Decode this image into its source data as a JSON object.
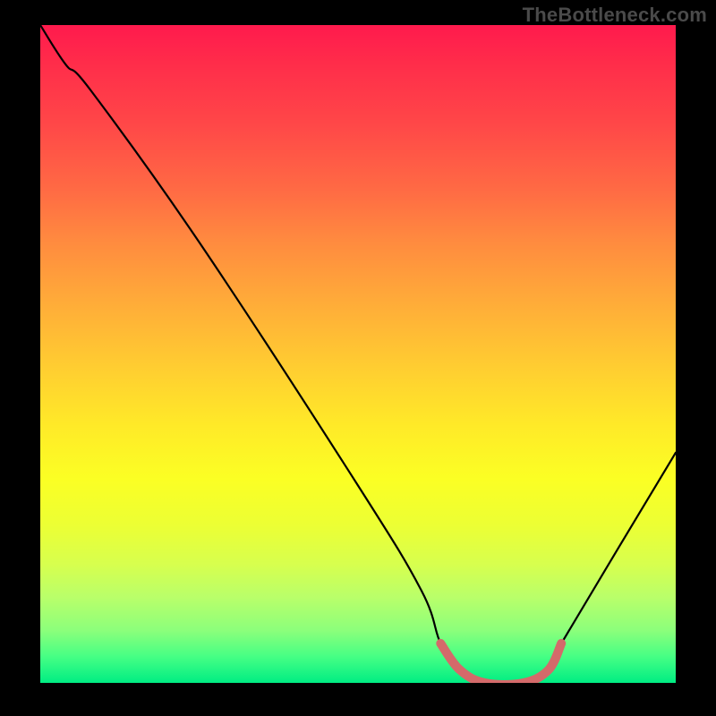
{
  "watermark": "TheBottleneck.com",
  "chart_data": {
    "type": "line",
    "title": "",
    "xlabel": "",
    "ylabel": "",
    "xlim": [
      0,
      100
    ],
    "ylim": [
      0,
      100
    ],
    "grid": false,
    "series": [
      {
        "name": "bottleneck-curve",
        "color": "#000000",
        "x": [
          0,
          4,
          8,
          25,
          50,
          60,
          63,
          66,
          70,
          76,
          80,
          82,
          100
        ],
        "values": [
          100,
          94,
          90,
          67,
          30,
          14,
          6,
          2,
          0,
          0,
          2,
          6,
          35
        ]
      }
    ],
    "highlight": {
      "name": "highlight-segment",
      "color": "#d46a6a",
      "x": [
        63,
        66,
        70,
        76,
        80,
        82
      ],
      "values": [
        6,
        2,
        0,
        0,
        2,
        6
      ]
    },
    "gradient_stops": [
      {
        "pos": 0,
        "color": "#ff1a4d"
      },
      {
        "pos": 50,
        "color": "#ffea28"
      },
      {
        "pos": 100,
        "color": "#00ed83"
      }
    ]
  }
}
